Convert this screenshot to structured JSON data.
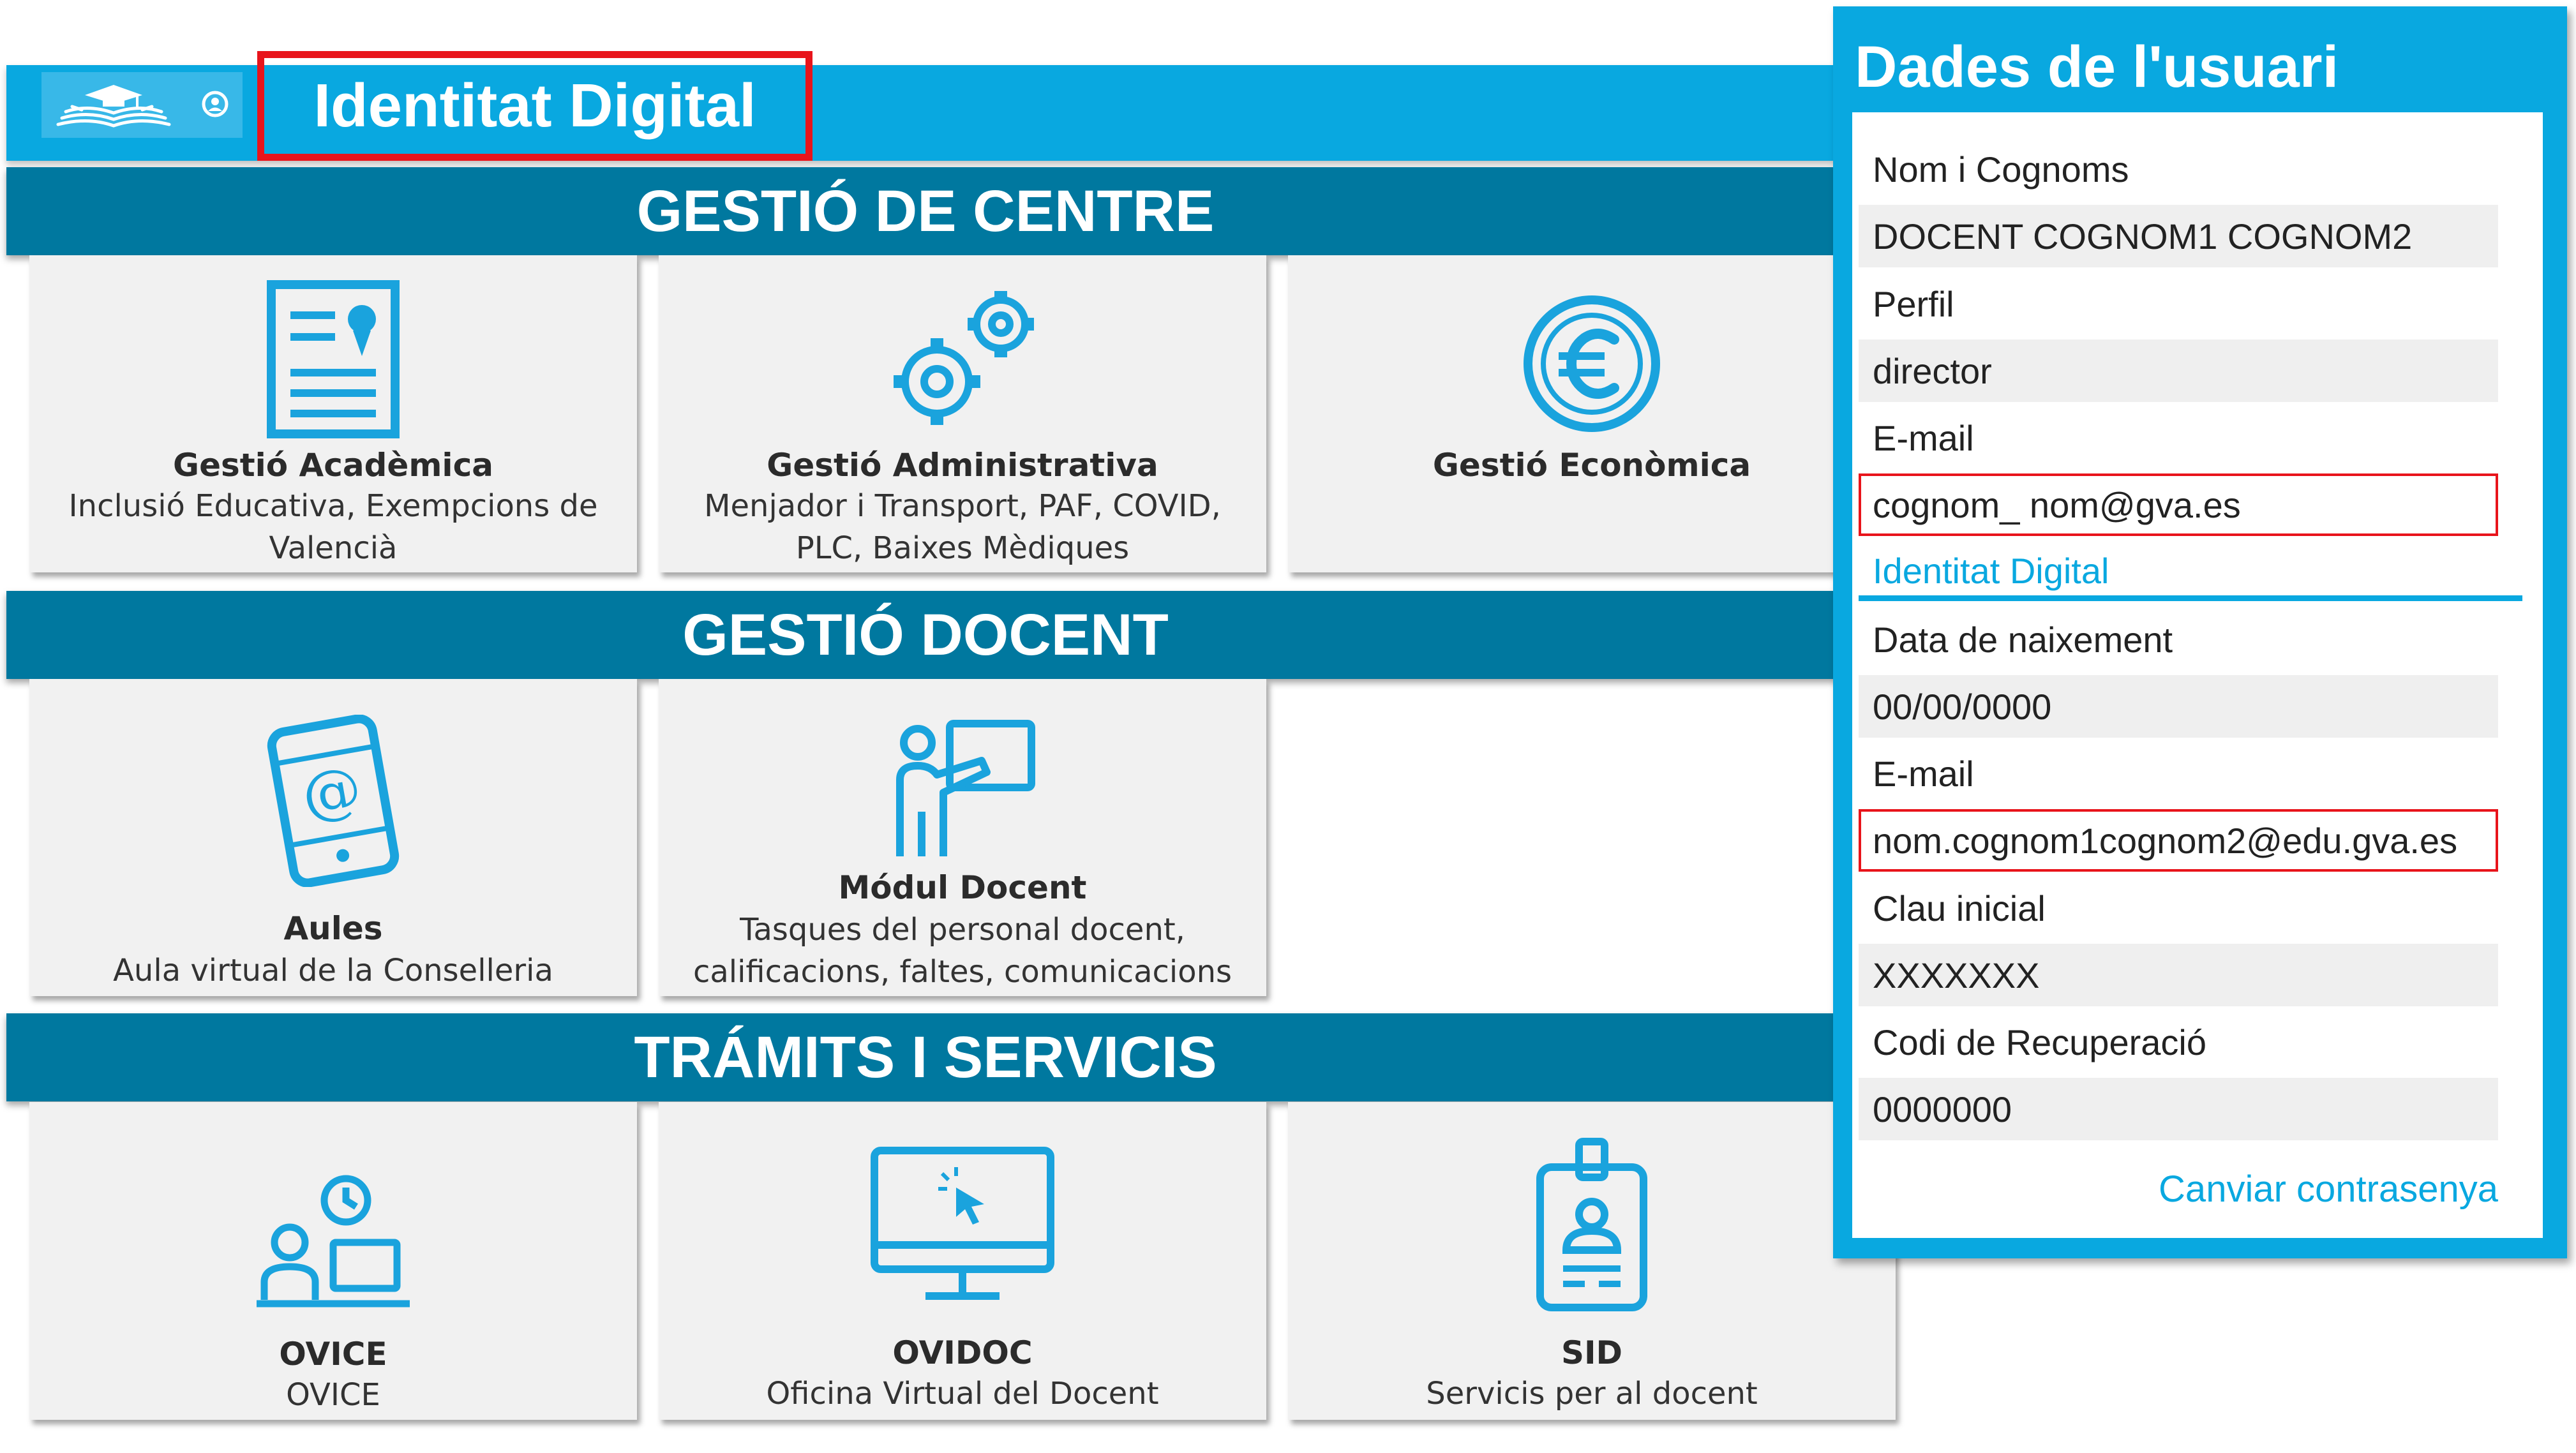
{
  "header": {
    "title": "Identitat Digital",
    "logo_icon": "book-graduation-cap-icon",
    "user_icon": "user-circle-icon",
    "bar_color": "#09a8e0",
    "highlight_color": "#e8141b"
  },
  "sections": [
    {
      "title": "GESTIÓ DE CENTRE",
      "cards": [
        {
          "icon": "document-badge-icon",
          "title": "Gestió Acadèmica",
          "subtitle": "Inclusió Educativa, Exempcions de Valencià"
        },
        {
          "icon": "gears-icon",
          "title": "Gestió Administrativa",
          "subtitle": "Menjador i Transport, PAF, COVID, PLC, Baixes Mèdiques"
        },
        {
          "icon": "euro-coin-icon",
          "title": "Gestió Econòmica",
          "subtitle": ""
        }
      ]
    },
    {
      "title": "GESTIÓ DOCENT",
      "cards": [
        {
          "icon": "tablet-at-icon",
          "title": "Aules",
          "subtitle": "Aula virtual de la Conselleria"
        },
        {
          "icon": "teacher-board-icon",
          "title": "Módul Docent",
          "subtitle": "Tasques del personal docent, calificacions, faltes, comunicacions"
        }
      ]
    },
    {
      "title": "TRÁMITS I SERVICIS",
      "cards": [
        {
          "icon": "office-clock-icon",
          "title": "OVICE",
          "subtitle": "OVICE"
        },
        {
          "icon": "monitor-click-icon",
          "title": "OVIDOC",
          "subtitle": "Oficina Virtual del Docent"
        },
        {
          "icon": "id-badge-icon",
          "title": "SID",
          "subtitle": "Servicis per al docent"
        }
      ]
    }
  ],
  "user_panel": {
    "title": "Dades de l'usuari",
    "rows": [
      "Nom i Cognoms",
      "DOCENT COGNOM1 COGNOM2",
      "Perfil",
      "director",
      "E-mail",
      "cognom_ nom@gva.es",
      "Identitat Digital",
      "Data de naixement",
      "00/00/0000",
      "E-mail",
      "nom.cognom1cognom2@edu.gva.es",
      "Clau inicial",
      "XXXXXXX",
      "Codi de Recuperació",
      "0000000"
    ],
    "change_password": "Canviar contrasenya"
  }
}
